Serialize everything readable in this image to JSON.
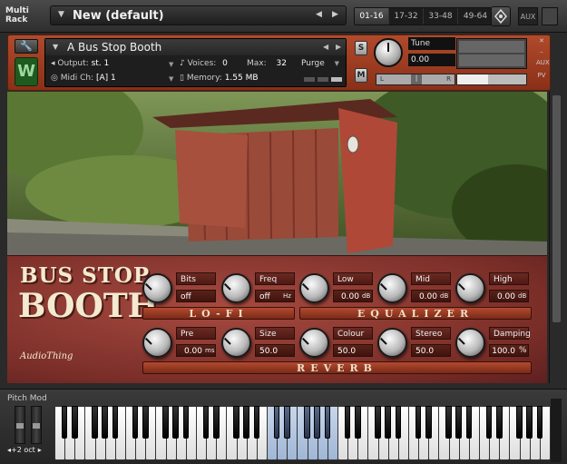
{
  "rack": {
    "title_line1": "Multi",
    "title_line2": "Rack",
    "preset_name": "New (default)",
    "ranges": [
      "01-16",
      "17-32",
      "33-48",
      "49-64"
    ],
    "aux_label": "AUX"
  },
  "instrument": {
    "name": "A Bus Stop Booth",
    "output_label": "Output:",
    "output_value": "st. 1",
    "voices_label": "Voices:",
    "voices_value": "0",
    "max_label": "Max:",
    "max_value": "32",
    "purge_label": "Purge",
    "midi_label": "Midi Ch:",
    "midi_value": "[A]  1",
    "memory_label": "Memory:",
    "memory_value": "1.55 MB",
    "solo_label": "S",
    "mute_label": "M",
    "tune_label": "Tune",
    "tune_value": "0.00",
    "pan_left": "L",
    "pan_right": "R",
    "volume_level": 0.45,
    "icon_letter": "W"
  },
  "panel": {
    "logo_line1": "BUS STOP",
    "logo_line2": "BOOTH",
    "maker_logo": "AudioThing",
    "sections": {
      "lofi": "LO-FI",
      "equalizer": "EQUALIZER",
      "reverb": "REVERB"
    },
    "params": [
      {
        "label": "Bits",
        "value": "off",
        "unit": ""
      },
      {
        "label": "Freq",
        "value": "off",
        "unit": "Hz"
      },
      {
        "label": "Low",
        "value": "0.00",
        "unit": "dB"
      },
      {
        "label": "Mid",
        "value": "0.00",
        "unit": "dB"
      },
      {
        "label": "High",
        "value": "0.00",
        "unit": "dB"
      },
      {
        "label": "Pre",
        "value": "0.00",
        "unit": "ms"
      },
      {
        "label": "Size",
        "value": "50.0",
        "unit": ""
      },
      {
        "label": "Colour",
        "value": "50.0",
        "unit": ""
      },
      {
        "label": "Stereo",
        "value": "50.0",
        "unit": ""
      },
      {
        "label": "Damping",
        "value": "100.0",
        "unit": "%"
      }
    ]
  },
  "keyboard": {
    "pitch_mod_label": "Pitch Mod",
    "octave_label": "+2 oct",
    "white_key_count": 49,
    "highlight_from": 21,
    "highlight_to": 27
  },
  "colors": {
    "header_red": "#a0402a",
    "panel_red": "#8a3a30",
    "highlight_keys": "#9fb6d6"
  }
}
